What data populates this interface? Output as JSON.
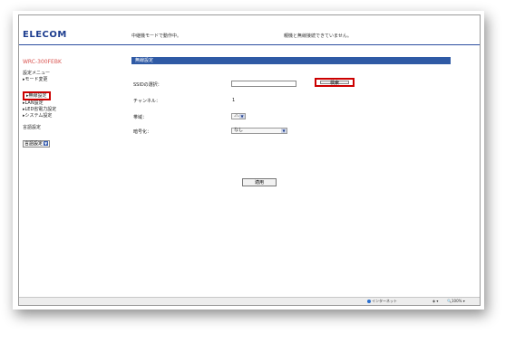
{
  "header": {
    "logo": "ELECOM",
    "mode_text": "中継機モードで動作中。",
    "status_text": "親機と無線接続できていません。"
  },
  "sidebar": {
    "device_name": "WRC-300FEBK",
    "menu_title": "設定メニュー",
    "items": [
      {
        "label": "▸モード変更"
      },
      {
        "label": "▸無線設定"
      },
      {
        "label": "▸LAN設定"
      },
      {
        "label": "▸LED省電力設定"
      },
      {
        "label": "▸システム設定"
      }
    ],
    "language_title": "言語設定",
    "language_value": "言語設定"
  },
  "main": {
    "section_title": "無線設定",
    "ssid_label": "SSIDの選択：",
    "search_button": "検索",
    "channel_label": "チャンネル：",
    "channel_value": "1",
    "band_label": "帯域：",
    "band_value": "2G",
    "encryption_label": "暗号化：",
    "encryption_value": "なし",
    "apply_button": "適用"
  },
  "statusbar": {
    "zone": "インターネット",
    "zoom": "100%"
  }
}
